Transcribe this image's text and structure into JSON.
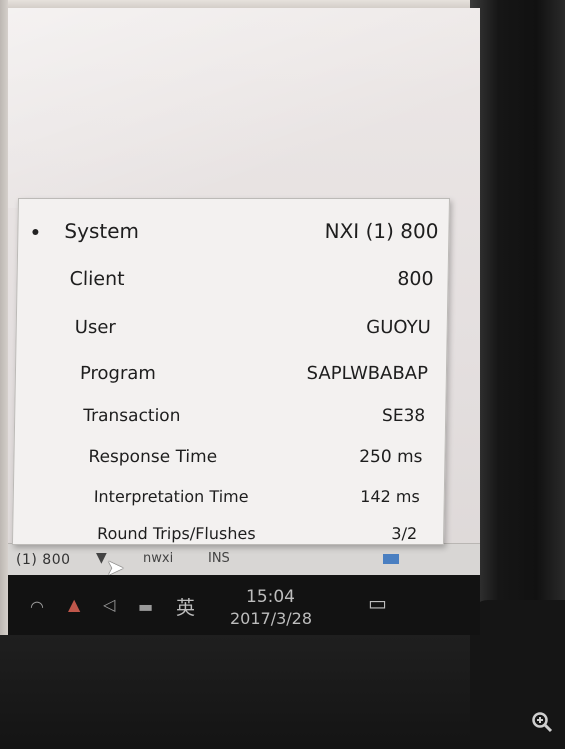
{
  "status_popup": {
    "rows": [
      {
        "label": "System",
        "value": "NXI (1) 800",
        "selected": true
      },
      {
        "label": "Client",
        "value": "800"
      },
      {
        "label": "User",
        "value": "GUOYU"
      },
      {
        "label": "Program",
        "value": "SAPLWBABAP"
      },
      {
        "label": "Transaction",
        "value": "SE38"
      },
      {
        "label": "Response Time",
        "value": "250 ms"
      },
      {
        "label": "Interpretation Time",
        "value": "142 ms"
      },
      {
        "label": "Round Trips/Flushes",
        "value": "3/2"
      }
    ]
  },
  "status_bar": {
    "text": "(1) 800",
    "host": "nwxi",
    "mode": "INS"
  },
  "taskbar": {
    "time": "15:04",
    "date": "2017/3/28",
    "ime": "英"
  },
  "icons": {
    "zoom": "zoom-in-icon",
    "wifi": "wifi-icon",
    "notification": "action-center-icon"
  }
}
